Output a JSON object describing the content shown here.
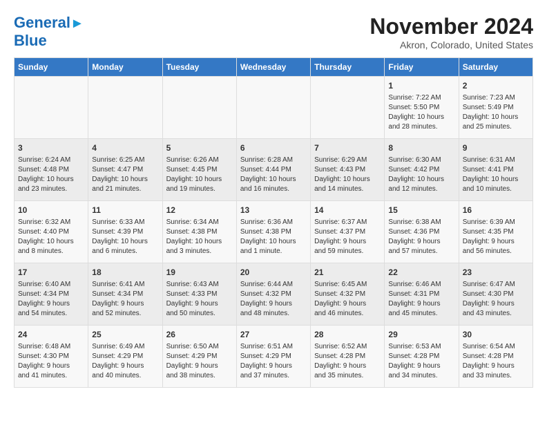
{
  "header": {
    "logo_line1": "General",
    "logo_line2": "Blue",
    "title": "November 2024",
    "subtitle": "Akron, Colorado, United States"
  },
  "weekdays": [
    "Sunday",
    "Monday",
    "Tuesday",
    "Wednesday",
    "Thursday",
    "Friday",
    "Saturday"
  ],
  "weeks": [
    [
      {
        "day": "",
        "info": ""
      },
      {
        "day": "",
        "info": ""
      },
      {
        "day": "",
        "info": ""
      },
      {
        "day": "",
        "info": ""
      },
      {
        "day": "",
        "info": ""
      },
      {
        "day": "1",
        "info": "Sunrise: 7:22 AM\nSunset: 5:50 PM\nDaylight: 10 hours\nand 28 minutes."
      },
      {
        "day": "2",
        "info": "Sunrise: 7:23 AM\nSunset: 5:49 PM\nDaylight: 10 hours\nand 25 minutes."
      }
    ],
    [
      {
        "day": "3",
        "info": "Sunrise: 6:24 AM\nSunset: 4:48 PM\nDaylight: 10 hours\nand 23 minutes."
      },
      {
        "day": "4",
        "info": "Sunrise: 6:25 AM\nSunset: 4:47 PM\nDaylight: 10 hours\nand 21 minutes."
      },
      {
        "day": "5",
        "info": "Sunrise: 6:26 AM\nSunset: 4:45 PM\nDaylight: 10 hours\nand 19 minutes."
      },
      {
        "day": "6",
        "info": "Sunrise: 6:28 AM\nSunset: 4:44 PM\nDaylight: 10 hours\nand 16 minutes."
      },
      {
        "day": "7",
        "info": "Sunrise: 6:29 AM\nSunset: 4:43 PM\nDaylight: 10 hours\nand 14 minutes."
      },
      {
        "day": "8",
        "info": "Sunrise: 6:30 AM\nSunset: 4:42 PM\nDaylight: 10 hours\nand 12 minutes."
      },
      {
        "day": "9",
        "info": "Sunrise: 6:31 AM\nSunset: 4:41 PM\nDaylight: 10 hours\nand 10 minutes."
      }
    ],
    [
      {
        "day": "10",
        "info": "Sunrise: 6:32 AM\nSunset: 4:40 PM\nDaylight: 10 hours\nand 8 minutes."
      },
      {
        "day": "11",
        "info": "Sunrise: 6:33 AM\nSunset: 4:39 PM\nDaylight: 10 hours\nand 6 minutes."
      },
      {
        "day": "12",
        "info": "Sunrise: 6:34 AM\nSunset: 4:38 PM\nDaylight: 10 hours\nand 3 minutes."
      },
      {
        "day": "13",
        "info": "Sunrise: 6:36 AM\nSunset: 4:38 PM\nDaylight: 10 hours\nand 1 minute."
      },
      {
        "day": "14",
        "info": "Sunrise: 6:37 AM\nSunset: 4:37 PM\nDaylight: 9 hours\nand 59 minutes."
      },
      {
        "day": "15",
        "info": "Sunrise: 6:38 AM\nSunset: 4:36 PM\nDaylight: 9 hours\nand 57 minutes."
      },
      {
        "day": "16",
        "info": "Sunrise: 6:39 AM\nSunset: 4:35 PM\nDaylight: 9 hours\nand 56 minutes."
      }
    ],
    [
      {
        "day": "17",
        "info": "Sunrise: 6:40 AM\nSunset: 4:34 PM\nDaylight: 9 hours\nand 54 minutes."
      },
      {
        "day": "18",
        "info": "Sunrise: 6:41 AM\nSunset: 4:34 PM\nDaylight: 9 hours\nand 52 minutes."
      },
      {
        "day": "19",
        "info": "Sunrise: 6:43 AM\nSunset: 4:33 PM\nDaylight: 9 hours\nand 50 minutes."
      },
      {
        "day": "20",
        "info": "Sunrise: 6:44 AM\nSunset: 4:32 PM\nDaylight: 9 hours\nand 48 minutes."
      },
      {
        "day": "21",
        "info": "Sunrise: 6:45 AM\nSunset: 4:32 PM\nDaylight: 9 hours\nand 46 minutes."
      },
      {
        "day": "22",
        "info": "Sunrise: 6:46 AM\nSunset: 4:31 PM\nDaylight: 9 hours\nand 45 minutes."
      },
      {
        "day": "23",
        "info": "Sunrise: 6:47 AM\nSunset: 4:30 PM\nDaylight: 9 hours\nand 43 minutes."
      }
    ],
    [
      {
        "day": "24",
        "info": "Sunrise: 6:48 AM\nSunset: 4:30 PM\nDaylight: 9 hours\nand 41 minutes."
      },
      {
        "day": "25",
        "info": "Sunrise: 6:49 AM\nSunset: 4:29 PM\nDaylight: 9 hours\nand 40 minutes."
      },
      {
        "day": "26",
        "info": "Sunrise: 6:50 AM\nSunset: 4:29 PM\nDaylight: 9 hours\nand 38 minutes."
      },
      {
        "day": "27",
        "info": "Sunrise: 6:51 AM\nSunset: 4:29 PM\nDaylight: 9 hours\nand 37 minutes."
      },
      {
        "day": "28",
        "info": "Sunrise: 6:52 AM\nSunset: 4:28 PM\nDaylight: 9 hours\nand 35 minutes."
      },
      {
        "day": "29",
        "info": "Sunrise: 6:53 AM\nSunset: 4:28 PM\nDaylight: 9 hours\nand 34 minutes."
      },
      {
        "day": "30",
        "info": "Sunrise: 6:54 AM\nSunset: 4:28 PM\nDaylight: 9 hours\nand 33 minutes."
      }
    ]
  ]
}
